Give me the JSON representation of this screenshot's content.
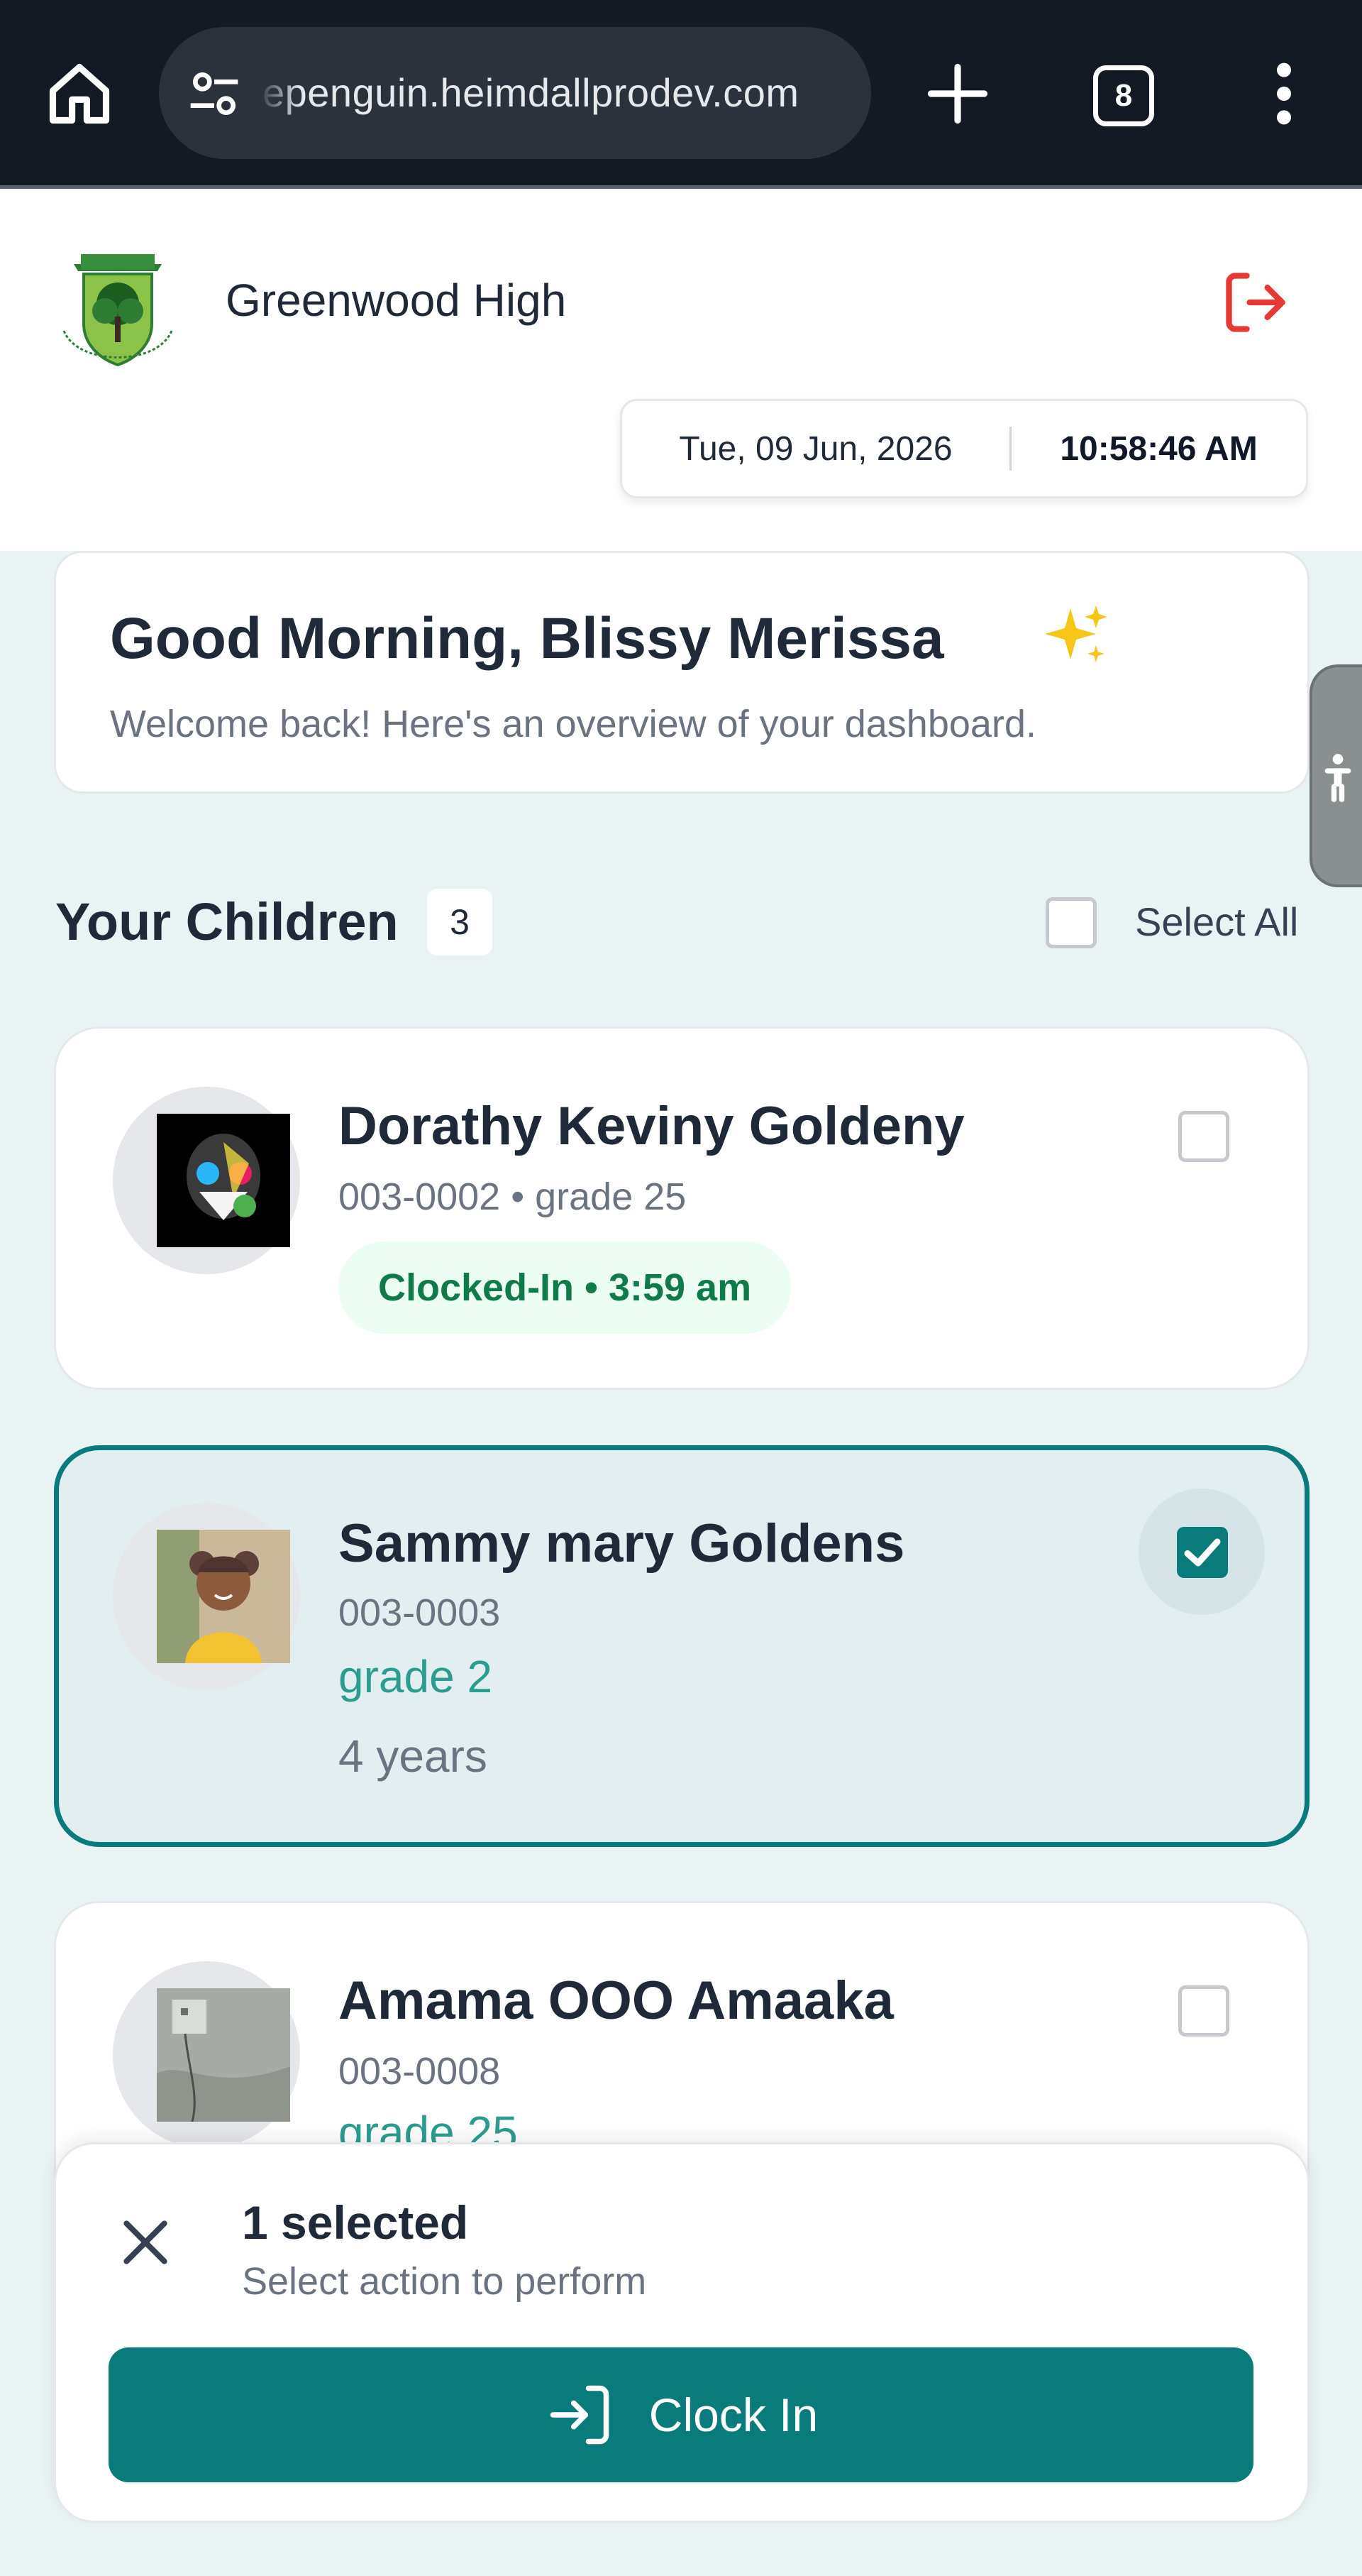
{
  "browser": {
    "url": "epenguin.heimdallprodev.com",
    "tab_count": "8",
    "icons": [
      "home-icon",
      "site-settings-icon",
      "new-tab-plus-icon",
      "tab-switcher-icon",
      "more-menu-icon"
    ]
  },
  "header": {
    "school_name": "Greenwood High",
    "date": "Tue, 09 Jun, 2026",
    "time": "10:58:46 AM",
    "logout_icon": "logout-icon",
    "brand_color": "#0a7b7b",
    "logout_color": "#e53935"
  },
  "greeting": {
    "title": "Good Morning, Blissy Merissa",
    "subtitle": "Welcome back! Here's an overview of your dashboard."
  },
  "children_section": {
    "title": "Your Children",
    "count": "3",
    "select_all_label": "Select All",
    "select_all_checked": false
  },
  "children": [
    {
      "name": "Dorathy Keviny Goldeny",
      "meta": "003-0002 • grade 25",
      "status": "Clocked-In • 3:59 am",
      "checked": false
    },
    {
      "name": "Sammy mary Goldens",
      "meta": "003-0003",
      "grade": "grade 2",
      "age": "4 years",
      "checked": true
    },
    {
      "name": "Amama OOO Amaaka",
      "meta": "003-0008",
      "grade": "grade 25",
      "checked": false
    }
  ],
  "action_sheet": {
    "selected_text": "1 selected",
    "subtitle": "Select action to perform",
    "primary_action": "Clock In"
  }
}
